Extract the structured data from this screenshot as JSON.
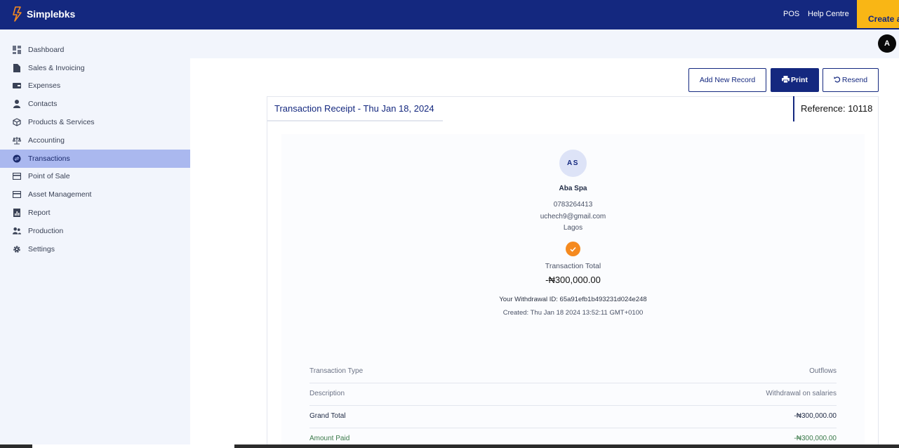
{
  "app": {
    "brand_name": "Simplebks",
    "brand_color": "#14287f",
    "accent_color": "#f9b615"
  },
  "topbar": {
    "pos_label": "POS",
    "help_label": "Help Centre",
    "create_label": "Create a",
    "avatar_letter": "A"
  },
  "sidebar": {
    "items": [
      {
        "label": "Dashboard",
        "icon": "dashboard-icon"
      },
      {
        "label": "Sales & Invoicing",
        "icon": "document-icon"
      },
      {
        "label": "Expenses",
        "icon": "wallet-icon"
      },
      {
        "label": "Contacts",
        "icon": "person-icon"
      },
      {
        "label": "Products & Services",
        "icon": "box-icon"
      },
      {
        "label": "Accounting",
        "icon": "scale-icon"
      },
      {
        "label": "Transactions",
        "icon": "exchange-icon",
        "active": true
      },
      {
        "label": "Point of Sale",
        "icon": "card-icon"
      },
      {
        "label": "Asset Management",
        "icon": "card-icon"
      },
      {
        "label": "Report",
        "icon": "report-icon"
      },
      {
        "label": "Production",
        "icon": "users-icon"
      },
      {
        "label": "Settings",
        "icon": "gear-icon"
      }
    ]
  },
  "actions": {
    "add_record": "Add New Record",
    "print": "Print",
    "resend": "Resend"
  },
  "receipt": {
    "title": "Transaction Receipt - Thu Jan 18, 2024",
    "reference": "Reference: 10118",
    "initials": "AS",
    "customer_name": "Aba Spa",
    "phone": "0783264413",
    "email": "uchech9@gmail.com",
    "city": "Lagos",
    "total_label": "Transaction Total",
    "total_amount": "-₦300,000.00",
    "withdrawal_id": "Your Withdrawal ID: 65a91efb1b493231d024e248",
    "created": "Created: Thu Jan 18 2024 13:52:11 GMT+0100",
    "rows": [
      {
        "label": "Transaction Type",
        "value": "Outflows"
      },
      {
        "label": "Description",
        "value": "Withdrawal on salaries"
      },
      {
        "label": "Grand Total",
        "value": "-₦300,000.00"
      },
      {
        "label": "Amount Paid",
        "value": "-₦300,000.00"
      }
    ]
  }
}
